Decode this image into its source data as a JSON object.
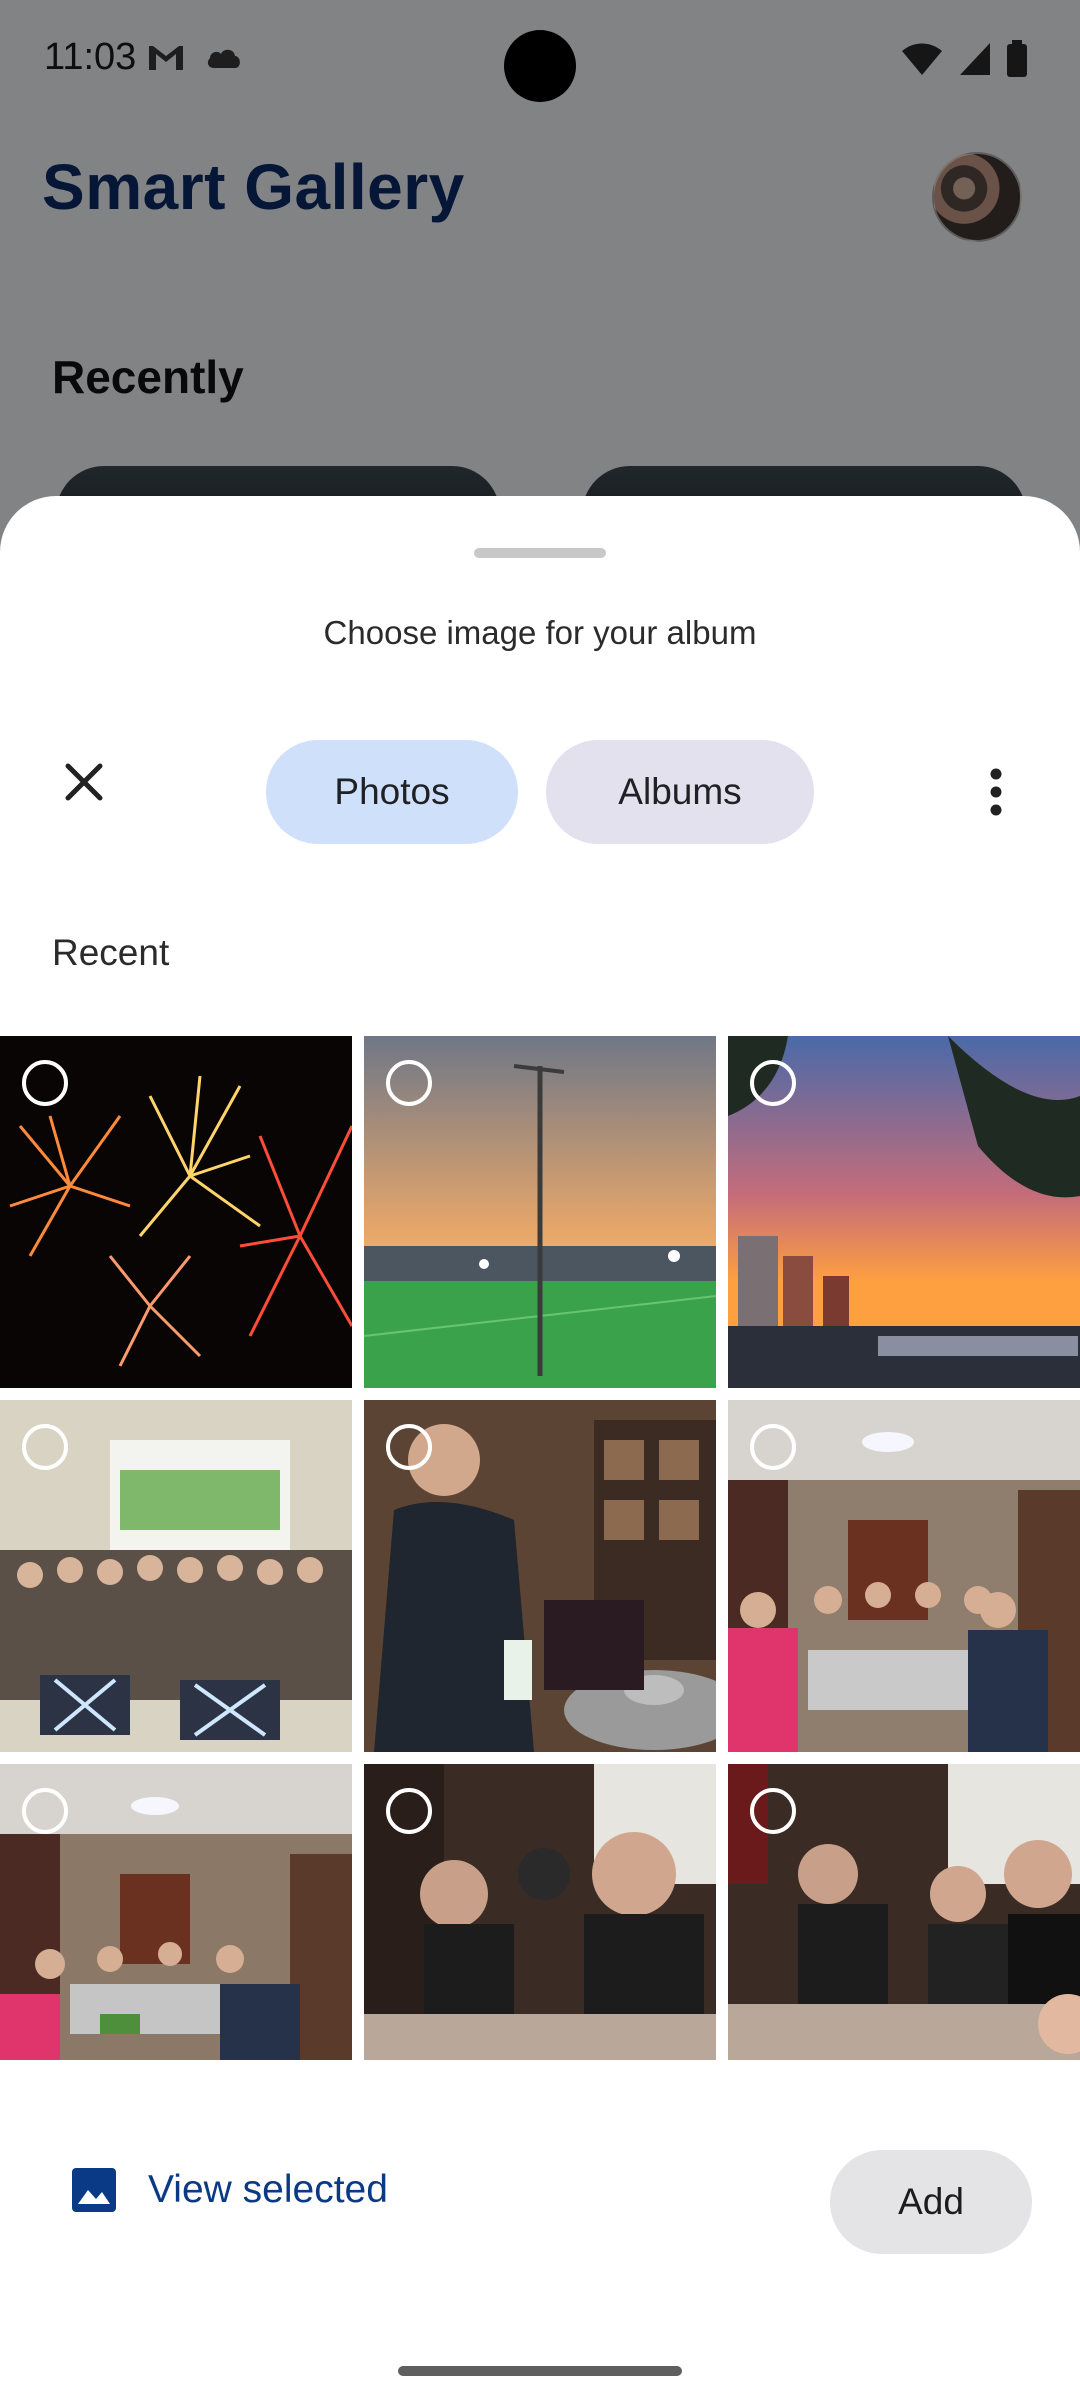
{
  "status_bar": {
    "time": "11:03"
  },
  "app": {
    "title": "Smart Gallery",
    "section_label": "Recently"
  },
  "sheet": {
    "title": "Choose image for your album",
    "tabs": [
      {
        "label": "Photos",
        "selected": true
      },
      {
        "label": "Albums",
        "selected": false
      }
    ],
    "section_label": "Recent",
    "photos": [
      {
        "icon": "fireworks-photo"
      },
      {
        "icon": "football-field-sunset-photo"
      },
      {
        "icon": "city-sunset-photo"
      },
      {
        "icon": "classroom-group-photo"
      },
      {
        "icon": "man-pouring-drink-photo"
      },
      {
        "icon": "restaurant-group-photo"
      },
      {
        "icon": "restaurant-dining-photo"
      },
      {
        "icon": "two-men-dinner-photo"
      },
      {
        "icon": "friends-dinner-photo"
      }
    ],
    "view_selected_label": "View selected",
    "add_label": "Add"
  },
  "colors": {
    "title_blue": "#0a2a66",
    "tab_selected": "#cfe0fb",
    "tab_unselected": "#e3e1ee",
    "link_blue": "#0a3a86"
  }
}
